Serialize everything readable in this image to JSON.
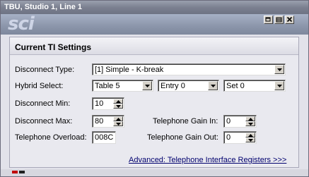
{
  "window": {
    "title": "TBU, Studio 1, Line 1",
    "logo": "sci"
  },
  "colors": {
    "link": "#00006e",
    "led_red": "#c00000",
    "led_dark": "#202020"
  },
  "panel": {
    "title": "Current TI Settings"
  },
  "fields": {
    "disconnect_type": {
      "label": "Disconnect Type:",
      "value": "[1] Simple - K-break"
    },
    "hybrid_select": {
      "label": "Hybrid Select:",
      "table": "Table 5",
      "entry": "Entry 0",
      "set": "Set 0"
    },
    "disconnect_min": {
      "label": "Disconnect Min:",
      "value": "10"
    },
    "disconnect_max": {
      "label": "Disconnect Max:",
      "value": "80"
    },
    "telephone_gain_in": {
      "label": "Telephone Gain In:",
      "value": "0"
    },
    "telephone_overload": {
      "label": "Telephone Overload:",
      "value": "008C"
    },
    "telephone_gain_out": {
      "label": "Telephone Gain Out:",
      "value": "0"
    }
  },
  "advanced_link": "Advanced: Telephone Interface Registers >>>"
}
